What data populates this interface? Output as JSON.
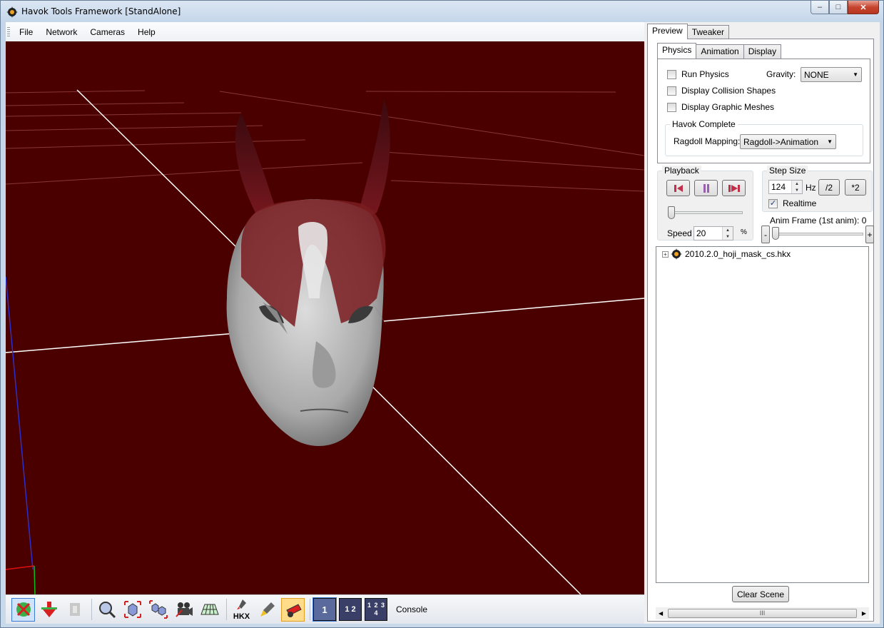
{
  "window": {
    "title": "Havok Tools Framework [StandAlone]",
    "caption": {
      "minimize": "–",
      "maximize": "□",
      "close": "✕"
    }
  },
  "menu": {
    "items": [
      "File",
      "Network",
      "Cameras",
      "Help"
    ]
  },
  "viewport": {
    "background_color": "#4b0000"
  },
  "toolbar": {
    "buttons": [
      {
        "icon": "transform-gizmo-icon",
        "active": true
      },
      {
        "icon": "gravity-arrow-icon"
      },
      {
        "icon": "disabled-tool-icon"
      },
      {
        "icon": "zoom-icon"
      },
      {
        "icon": "frame-selected-cube-icon"
      },
      {
        "icon": "frame-all-cubes-icon"
      },
      {
        "icon": "camera-icon"
      },
      {
        "icon": "grid-icon"
      },
      {
        "icon": "hkx-rocket-icon",
        "label": "HKX"
      },
      {
        "icon": "rocket-icon"
      },
      {
        "icon": "cannon-icon",
        "pressed": true
      }
    ],
    "layouts": [
      {
        "icon": "single-view-icon",
        "label": "1",
        "selected": true
      },
      {
        "icon": "two-view-icon",
        "label": "1 2"
      },
      {
        "icon": "four-view-icon",
        "label": "1 2 3 4"
      }
    ],
    "console_label": "Console"
  },
  "panel": {
    "outer_tabs": [
      "Preview",
      "Tweaker"
    ],
    "inner_tabs": [
      "Physics",
      "Animation",
      "Display"
    ],
    "physics": {
      "run_physics": "Run Physics",
      "gravity_label": "Gravity:",
      "gravity_value": "NONE",
      "display_collision": "Display Collision Shapes",
      "display_graphic": "Display Graphic Meshes",
      "havok_complete": {
        "title": "Havok Complete",
        "ragdoll_label": "Ragdoll Mapping:",
        "ragdoll_value": "Ragdoll->Animation"
      }
    },
    "playback": {
      "title": "Playback",
      "speed_label": "Speed",
      "speed_value": "20",
      "speed_unit": "%"
    },
    "step_size": {
      "title": "Step Size",
      "value": "124",
      "unit": "Hz",
      "halve": "/2",
      "double": "*2",
      "realtime_label": "Realtime",
      "realtime_checked": "✓"
    },
    "anim_frame": {
      "label": "Anim Frame (1st anim): 0",
      "minus": "-",
      "plus": "+"
    },
    "tree": {
      "items": [
        {
          "expander": "+",
          "label": "2010.2.0_hoji_mask_cs.hkx"
        }
      ]
    },
    "clear_scene": "Clear Scene",
    "scroll_grip": "III"
  }
}
